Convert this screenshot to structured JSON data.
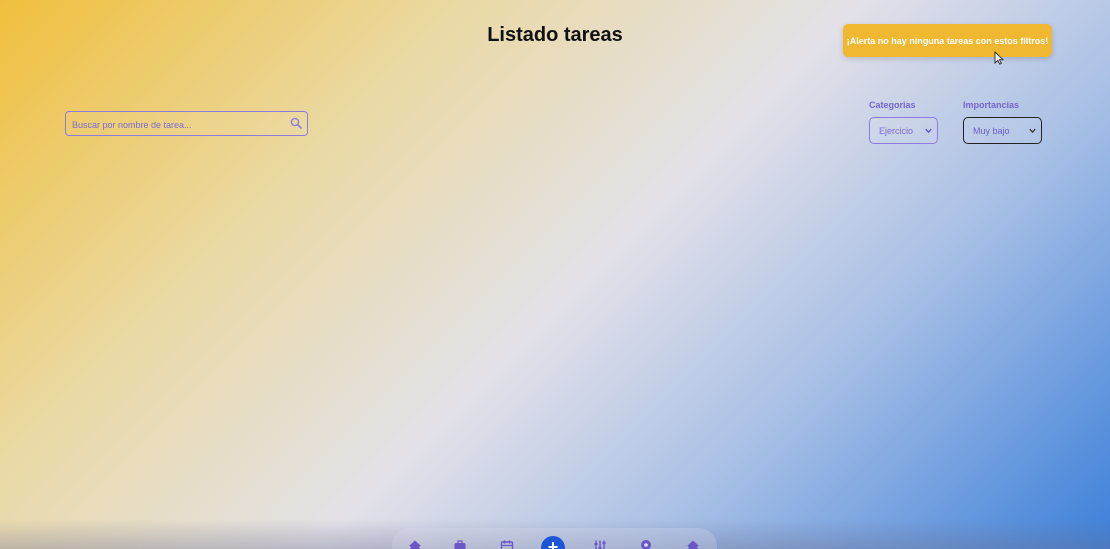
{
  "header": {
    "title": "Listado tareas"
  },
  "alert": {
    "message": "¡Alerta no hay ninguna tareas con estos filtros!",
    "color": "#f0b730"
  },
  "search": {
    "placeholder": "Buscar por nombre de tarea...",
    "value": "",
    "icon": "search-icon"
  },
  "filters": {
    "categorias": {
      "label": "Categorias",
      "selected": "Ejercicio"
    },
    "importancias": {
      "label": "Importancias",
      "selected": "Muy bajo"
    }
  },
  "bottom_nav": {
    "items": [
      {
        "icon": "home-icon"
      },
      {
        "icon": "briefcase-icon"
      },
      {
        "icon": "calendar-icon"
      },
      {
        "icon": "add-icon",
        "label": "+"
      },
      {
        "icon": "sliders-icon"
      },
      {
        "icon": "location-icon"
      },
      {
        "icon": "home-icon"
      }
    ],
    "accent": "#1e55d8"
  }
}
